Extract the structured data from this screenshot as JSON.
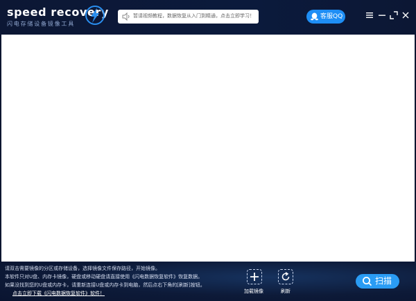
{
  "header": {
    "logo_title": "speed recovery",
    "logo_subtitle": "闪电存储设备镜像工具",
    "logo_icon": "lightning-bolt-icon",
    "notice_text": "暂请视频教程，数据恢复从入门到精通，点击立即学习！",
    "notice_icon": "speaker-icon",
    "qq_label": "客服QQ",
    "qq_icon": "qq-penguin-icon",
    "window_controls": [
      "menu-icon",
      "minimize-icon",
      "maximize-icon",
      "close-icon"
    ]
  },
  "footer": {
    "instructions": [
      "请双击需要镜像的分区或存储设备，选择镜像文件保存路径，开始镜像。",
      "本软件只对U盘、内存卡镜像，硬盘或移动硬盘请直接使用《闪电数据恢复软件》恢复数据。",
      "如果没找到您的U盘或内存卡，请重新连接U盘或内存卡到电脑，然后点右下角的[刷新]按钮。"
    ],
    "download_link": "点击立即下载《闪电数据恢复软件》软件！",
    "load_image_label": "加载镜像",
    "refresh_label": "刷新",
    "scan_label": "扫描"
  },
  "colors": {
    "background": "#0b1530",
    "accent": "#1e8ef5",
    "scan_button": "#2a9cf4",
    "panel": "#ffffff"
  }
}
